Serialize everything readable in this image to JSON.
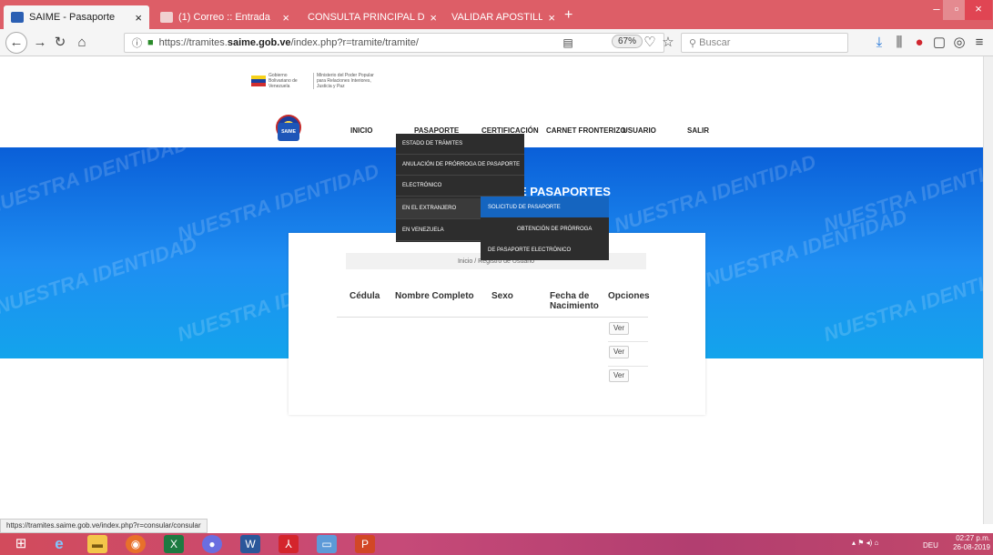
{
  "browser": {
    "tabs": [
      {
        "title": "SAIME - Pasaporte",
        "active": true
      },
      {
        "title": "(1) Correo :: Entrada",
        "active": false
      },
      {
        "title": "CONSULTA PRINCIPAL DE PLANILL",
        "active": false
      },
      {
        "title": "VALIDAR APOSTILLA | MPPRE",
        "active": false
      }
    ],
    "new_tab": "+",
    "close": "×",
    "url_prefix": "https://tramites.",
    "url_domain": "saime.gob.ve",
    "url_suffix": "/index.php?r=tramite/tramite/",
    "zoom": "67%",
    "search_placeholder": "Buscar",
    "status_url": "https://tramites.saime.gob.ve/index.php?r=consular/consular"
  },
  "site": {
    "gov_text": "Gobierno Bolivariano de Venezuela",
    "ministry_text": "Ministerio del Poder Popular para Relaciones Interiores, Justicia y Paz",
    "saime_logo": "SAIME",
    "watermark": "NUESTRA IDENTIDAD",
    "nav": [
      "INICIO",
      "PASAPORTE",
      "CERTIFICACIÓN",
      "CARNET FRONTERIZO",
      "USUARIO",
      "SALIR"
    ],
    "section_title": "E PASAPORTES",
    "dropdown_main": [
      "ESTADO DE TRÁMITES",
      "ANULACIÓN DE PRÓRROGA DE PASAPORTE",
      "ELECTRÓNICO",
      "EN EL EXTRANJERO",
      "EN VENEZUELA"
    ],
    "dropdown_sub": [
      "SOLICITUD DE PASAPORTE",
      "OBTENCIÓN DE PRÓRROGA",
      "DE PASAPORTE ELECTRÓNICO"
    ],
    "breadcrumb": "Inicio  /  Registro de Usuario",
    "table": {
      "headers": [
        "Cédula",
        "Nombre Completo",
        "Sexo",
        "Fecha de Nacimiento",
        "Opciones"
      ],
      "rows": [
        {
          "action": "Ver"
        },
        {
          "action": "Ver"
        },
        {
          "action": "Ver"
        }
      ]
    }
  },
  "taskbar": {
    "lang": "DEU",
    "time": "02:27 p.m.",
    "date": "26-08-2019"
  }
}
